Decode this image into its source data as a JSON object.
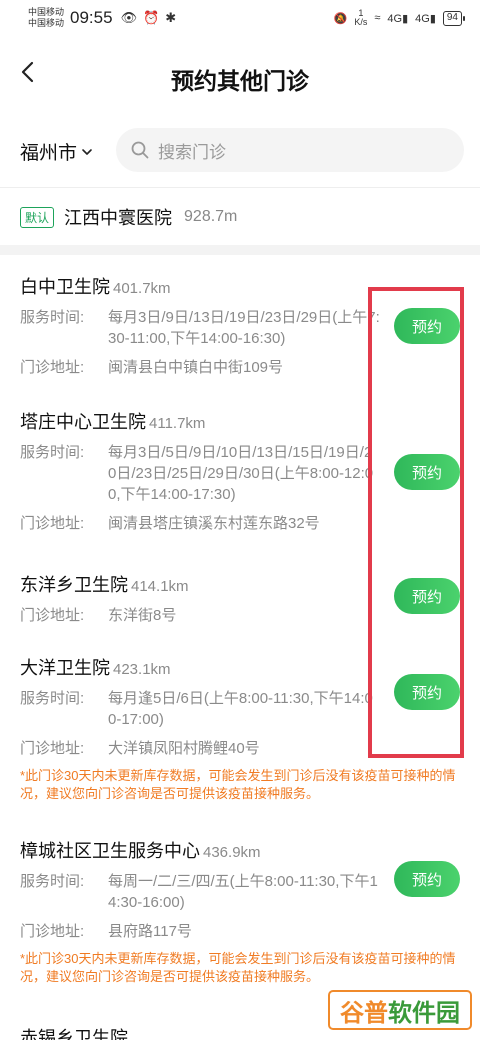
{
  "status_bar": {
    "carrier1": "中国移动",
    "carrier2": "中国移动",
    "time": "09:55",
    "speed_value": "1",
    "speed_unit": "K/s",
    "signal1": "4G",
    "signal2": "4G",
    "battery": "94"
  },
  "header": {
    "title": "预约其他门诊"
  },
  "search": {
    "city": "福州市",
    "placeholder": "搜索门诊"
  },
  "default_clinic": {
    "tag": "默认",
    "name": "江西中寰医院",
    "distance": "928.7m"
  },
  "labels": {
    "hours": "服务时间:",
    "address": "门诊地址:",
    "book": "预约"
  },
  "clinics": [
    {
      "name": "白中卫生院",
      "distance": "401.7km",
      "hours": "每月3日/9日/13日/19日/23日/29日(上午7:30-11:00,下午14:00-16:30)",
      "address": "闽清县白中镇白中街109号"
    },
    {
      "name": "塔庄中心卫生院",
      "distance": "411.7km",
      "hours": "每月3日/5日/9日/10日/13日/15日/19日/20日/23日/25日/29日/30日(上午8:00-12:00,下午14:00-17:30)",
      "address": "闽清县塔庄镇溪东村莲东路32号"
    },
    {
      "name": "东洋乡卫生院",
      "distance": "414.1km",
      "address": "东洋街8号"
    },
    {
      "name": "大洋卫生院",
      "distance": "423.1km",
      "hours": "每月逢5日/6日(上午8:00-11:30,下午14:00-17:00)",
      "address": "大洋镇凤阳村腾鲤40号",
      "warning": "*此门诊30天内未更新库存数据，可能会发生到门诊后没有该疫苗可接种的情况，建议您向门诊咨询是否可提供该疫苗接种服务。"
    },
    {
      "name": "樟城社区卫生服务中心",
      "distance": "436.9km",
      "hours": "每周一/二/三/四/五(上午8:00-11:30,下午14:30-16:00)",
      "address": "县府路117号",
      "warning": "*此门诊30天内未更新库存数据，可能会发生到门诊后没有该疫苗可接种的情况，建议您向门诊咨询是否可提供该疫苗接种服务。"
    },
    {
      "name": "赤锡乡卫生院",
      "distance": ""
    }
  ],
  "watermark": {
    "part1": "谷普",
    "part2": "软件园"
  }
}
